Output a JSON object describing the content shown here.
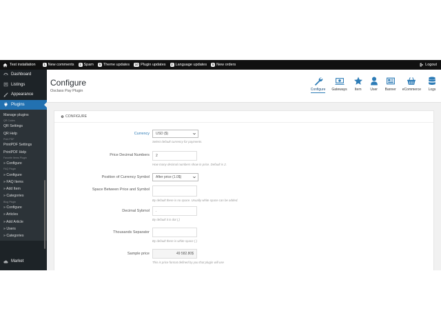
{
  "topbar": {
    "site": "Test installation",
    "items": [
      {
        "count": "1",
        "label": "New comments"
      },
      {
        "count": "1",
        "label": "Spam"
      },
      {
        "count": "6",
        "label": "Theme updates"
      },
      {
        "count": "10",
        "label": "Plugin updates"
      },
      {
        "count": "2",
        "label": "Language updates"
      },
      {
        "count": "5",
        "label": "New orders"
      }
    ],
    "logout": "Logout"
  },
  "sidebar": {
    "main": [
      {
        "label": "Dashboard",
        "icon": "dashboard-icon"
      },
      {
        "label": "Listings",
        "icon": "listings-icon"
      },
      {
        "label": "Appearance",
        "icon": "brush-icon"
      },
      {
        "label": "Plugins",
        "icon": "plugin-icon"
      }
    ],
    "submenu": [
      {
        "type": "item",
        "label": "Manage plugins"
      },
      {
        "type": "head",
        "label": "QR Codes"
      },
      {
        "type": "item",
        "label": "QR Settings"
      },
      {
        "type": "item",
        "label": "QR Help"
      },
      {
        "type": "head",
        "label": "Print PDF"
      },
      {
        "type": "item",
        "label": "PrintPDF Settings"
      },
      {
        "type": "item",
        "label": "PrintPDF Help"
      },
      {
        "type": "head",
        "label": "Favorite Items Plugin"
      },
      {
        "type": "item",
        "label": "» Configure"
      },
      {
        "type": "head",
        "label": "FAQ Plugin"
      },
      {
        "type": "item",
        "label": "» Configure"
      },
      {
        "type": "item",
        "label": "» FAQ Items"
      },
      {
        "type": "item",
        "label": "» Add Item"
      },
      {
        "type": "item",
        "label": "» Categories"
      },
      {
        "type": "head",
        "label": "Blog Plugin"
      },
      {
        "type": "item",
        "label": "» Configure"
      },
      {
        "type": "item",
        "label": "» Articles"
      },
      {
        "type": "item",
        "label": "» Add Article"
      },
      {
        "type": "item",
        "label": "» Users"
      },
      {
        "type": "item",
        "label": "» Categories"
      }
    ],
    "market": "Market"
  },
  "header": {
    "title": "Configure",
    "subtitle": "Osclass Pay Plugin",
    "tabs": [
      {
        "label": "Configure",
        "icon": "wrench-icon",
        "active": true
      },
      {
        "label": "Gateways",
        "icon": "gateway-icon",
        "active": false
      },
      {
        "label": "Item",
        "icon": "star-icon",
        "active": false
      },
      {
        "label": "User",
        "icon": "user-icon",
        "active": false
      },
      {
        "label": "Banner",
        "icon": "banner-icon",
        "active": false
      },
      {
        "label": "eCommerce",
        "icon": "basket-icon",
        "active": false
      },
      {
        "label": "Logs",
        "icon": "database-icon",
        "active": false
      }
    ]
  },
  "panel": {
    "title": "CONFIGURE",
    "fields": [
      {
        "label": "Currency",
        "value": "USD ($)",
        "type": "select",
        "help": "Select default currency for payments."
      },
      {
        "label": "Price Decimal Numbers",
        "value": "2",
        "type": "input",
        "help": "How many decimal numbers show in price. Default is 2."
      },
      {
        "label": "Position of Currency Symbol",
        "value": "After price (1.0$)",
        "type": "select",
        "help": ""
      },
      {
        "label": "Space Between Price and Symbol",
        "value": "",
        "type": "textarea",
        "help": "By default there is no space. Usually white space can be added."
      },
      {
        "label": "Decimal Sybmol",
        "value": ".",
        "type": "input",
        "help": "By default it is dot (.)"
      },
      {
        "label": "Thousands Separator",
        "value": "",
        "type": "input",
        "help": "By default there is white space ( )"
      },
      {
        "label": "Sample price",
        "value": "49 582.80$",
        "type": "readonly",
        "help": "This is price format defined by you that plugin will use"
      }
    ]
  }
}
